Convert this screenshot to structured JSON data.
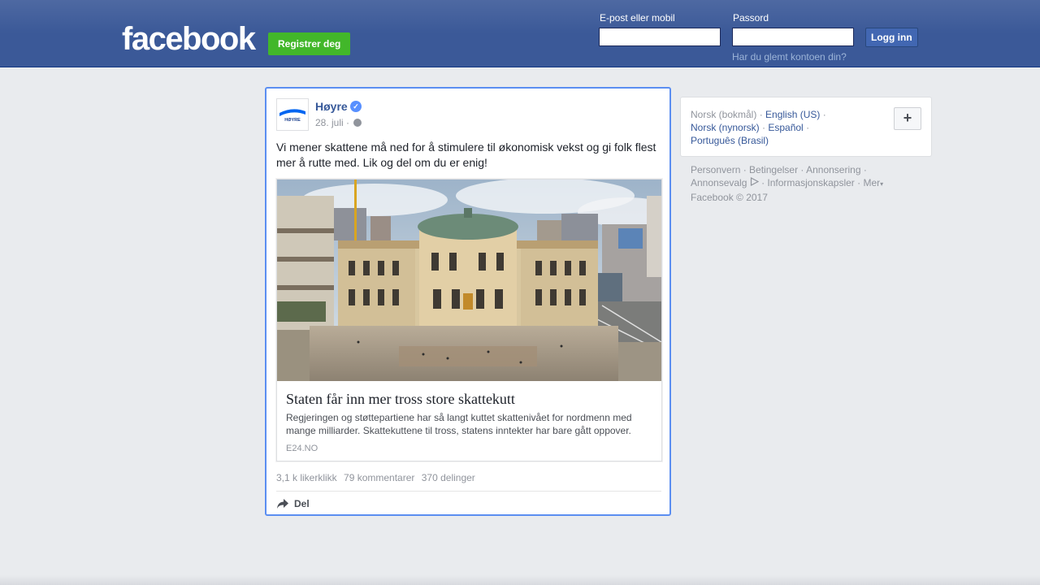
{
  "header": {
    "logo": "facebook",
    "register_label": "Registrer deg",
    "email_label": "E-post eller mobil",
    "password_label": "Passord",
    "login_label": "Logg inn",
    "forgot_label": "Har du glemt kontoen din?"
  },
  "post": {
    "page_name": "Høyre",
    "avatar_text": "HØYRE",
    "date": "28. juli ·",
    "text": "Vi mener skattene må ned for å stimulere til økonomisk vekst og gi folk flest mer å rutte med. Lik og del om du er enig!",
    "link": {
      "title": "Staten får inn mer tross store skattekutt",
      "description": "Regjeringen og støttepartiene har så langt kuttet skattenivået for nordmenn med mange milliarder. Skattekuttene til tross, statens inntekter har bare gått oppover.",
      "source": "E24.NO"
    },
    "stats": {
      "likes": "3,1 k likerklikk",
      "comments": "79 kommentarer",
      "shares": "370 delinger"
    },
    "share_label": "Del"
  },
  "sidebar": {
    "languages": {
      "current": "Norsk (bokmål)",
      "english": "English (US)",
      "nynorsk": "Norsk (nynorsk)",
      "espanol": "Español",
      "portugues": "Português (Brasil)"
    },
    "add_language": "+",
    "footer": {
      "privacy": "Personvern",
      "terms": "Betingelser",
      "advertising": "Annonsering",
      "ad_choices": "Annonsevalg",
      "cookies": "Informasjonskapsler",
      "more": "Mer",
      "copyright": "Facebook © 2017"
    }
  },
  "colors": {
    "brand_blue": "#3b5998",
    "register_green": "#42b72a",
    "link_blue": "#365899",
    "focus_border": "#5b8ef1"
  }
}
